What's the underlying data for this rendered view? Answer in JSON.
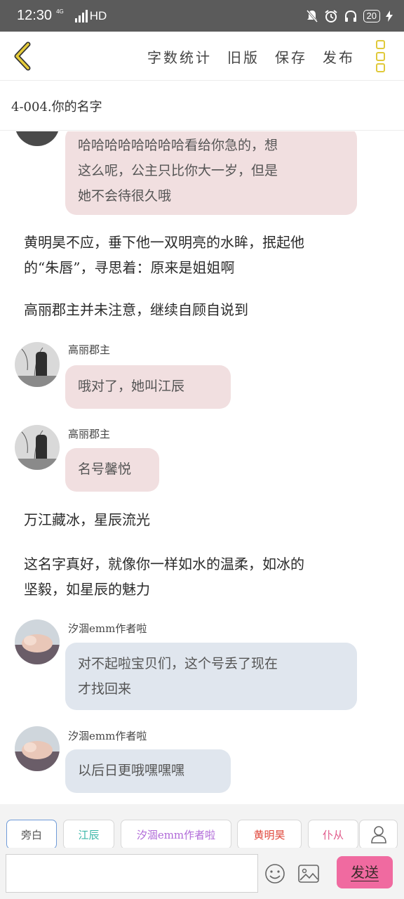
{
  "status_bar": {
    "time": "12:30",
    "network": "4G",
    "hd": "HD",
    "battery": "20"
  },
  "header": {
    "actions": [
      "字数统计",
      "旧版",
      "保存",
      "发布"
    ],
    "accent_color": "#e0c93a"
  },
  "chapter_title": "4-004.你的名字",
  "messages": [
    {
      "kind": "bubble",
      "speaker": "",
      "color": "pink",
      "lines": [
        "哈哈哈哈哈哈哈哈看给你急的，想",
        "这么呢，公主只比你大一岁，但是",
        "她不会待很久哦"
      ]
    },
    {
      "kind": "narration",
      "lines": [
        "黄明昊不应，垂下他一双明亮的水眸，抿起他",
        "的“朱唇”，寻思着：原来是姐姐啊"
      ]
    },
    {
      "kind": "narration",
      "lines": [
        "高丽郡主并未注意，继续自顾自说到"
      ]
    },
    {
      "kind": "bubble",
      "speaker": "高丽郡主",
      "color": "pink",
      "lines": [
        "哦对了，她叫江辰"
      ]
    },
    {
      "kind": "bubble",
      "speaker": "高丽郡主",
      "color": "pink",
      "lines": [
        "名号馨悦"
      ]
    },
    {
      "kind": "narration",
      "lines": [
        "万江藏冰，星辰流光"
      ]
    },
    {
      "kind": "narration",
      "lines": [
        "这名字真好，就像你一样如水的温柔，如冰的",
        "坚毅，如星辰的魅力"
      ]
    },
    {
      "kind": "bubble",
      "speaker": "汐涸emm作者啦",
      "color": "blue",
      "lines": [
        "对不起啦宝贝们，这个号丢了现在",
        "才找回来"
      ]
    },
    {
      "kind": "bubble",
      "speaker": "汐涸emm作者啦",
      "color": "blue",
      "lines": [
        "以后日更哦嘿嘿嘿"
      ]
    }
  ],
  "roles": [
    {
      "label": "旁白",
      "color": "#555555",
      "active": true
    },
    {
      "label": "江辰",
      "color": "#3bb7a8",
      "active": false
    },
    {
      "label": "汐涸emm作者啦",
      "color": "#b06ad8",
      "active": false
    },
    {
      "label": "黄明昊",
      "color": "#e0463a",
      "active": false
    },
    {
      "label": "仆从",
      "color": "#e05a8a",
      "active": false
    }
  ],
  "input": {
    "value": "",
    "placeholder": ""
  },
  "send_label": "发送",
  "colors": {
    "pink_bubble": "#f1dfe0",
    "blue_bubble": "#e0e6ee",
    "send_button": "#f06aa0"
  }
}
